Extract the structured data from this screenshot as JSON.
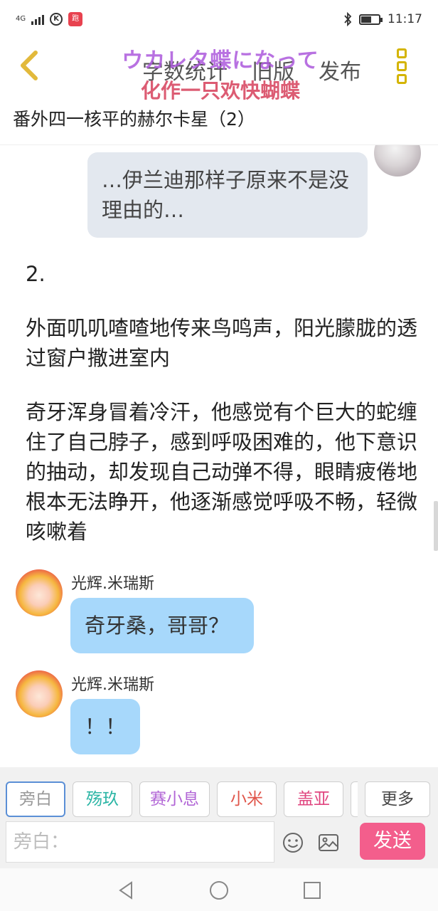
{
  "status_bar": {
    "network": "4G",
    "k_icon": "K",
    "app_badge": "跑",
    "time": "11:17",
    "icons": [
      "signal-icon",
      "k-circle-icon",
      "app-notification-icon",
      "bluetooth-icon",
      "battery-icon"
    ]
  },
  "header": {
    "actions": [
      "字数统计",
      "旧版",
      "发布"
    ],
    "watermark_line1": "ウカレタ蝶になって",
    "watermark_line2": "化作一只欢快蝴蝶",
    "title": "番外四一核平的赫尔卡星（2）"
  },
  "messages": [
    {
      "type": "bubble",
      "side": "right",
      "avatar": "gray",
      "text": "…伊兰迪那样子原来不是没理由的…"
    },
    {
      "type": "narration",
      "text": "2."
    },
    {
      "type": "narration",
      "text": "外面叽叽喳喳地传来鸟鸣声，阳光朦胧的透过窗户撒进室内"
    },
    {
      "type": "narration",
      "text": "奇牙浑身冒着冷汗，他感觉有个巨大的蛇缠住了自己脖子，感到呼吸困难的，他下意识的抽动，却发现自己动弹不得，眼睛疲倦地根本无法睁开，他逐渐感觉呼吸不畅，轻微咳嗽着"
    },
    {
      "type": "bubble",
      "side": "left",
      "speaker": "光辉.米瑞斯",
      "avatar": "colorful",
      "text": "奇牙桑，哥哥？"
    },
    {
      "type": "bubble",
      "side": "left",
      "speaker": "光辉.米瑞斯",
      "avatar": "colorful",
      "text": "！！"
    }
  ],
  "composer": {
    "chips": [
      {
        "label": "旁白",
        "color": "#999999",
        "active": true
      },
      {
        "label": "殇玖",
        "color": "#2bb5a5",
        "active": false
      },
      {
        "label": "赛小息",
        "color": "#b266d6",
        "active": false
      },
      {
        "label": "小米",
        "color": "#e0554a",
        "active": false
      },
      {
        "label": "盖亚",
        "color": "#e0457f",
        "active": false
      }
    ],
    "more_label": "更多",
    "input_placeholder": "旁白：",
    "send_label": "发送"
  },
  "colors": {
    "accent": "#f35e8c",
    "left_bubble": "#a7d8fb",
    "right_bubble": "#e3e8ef",
    "menu_icon": "#d4b400"
  }
}
